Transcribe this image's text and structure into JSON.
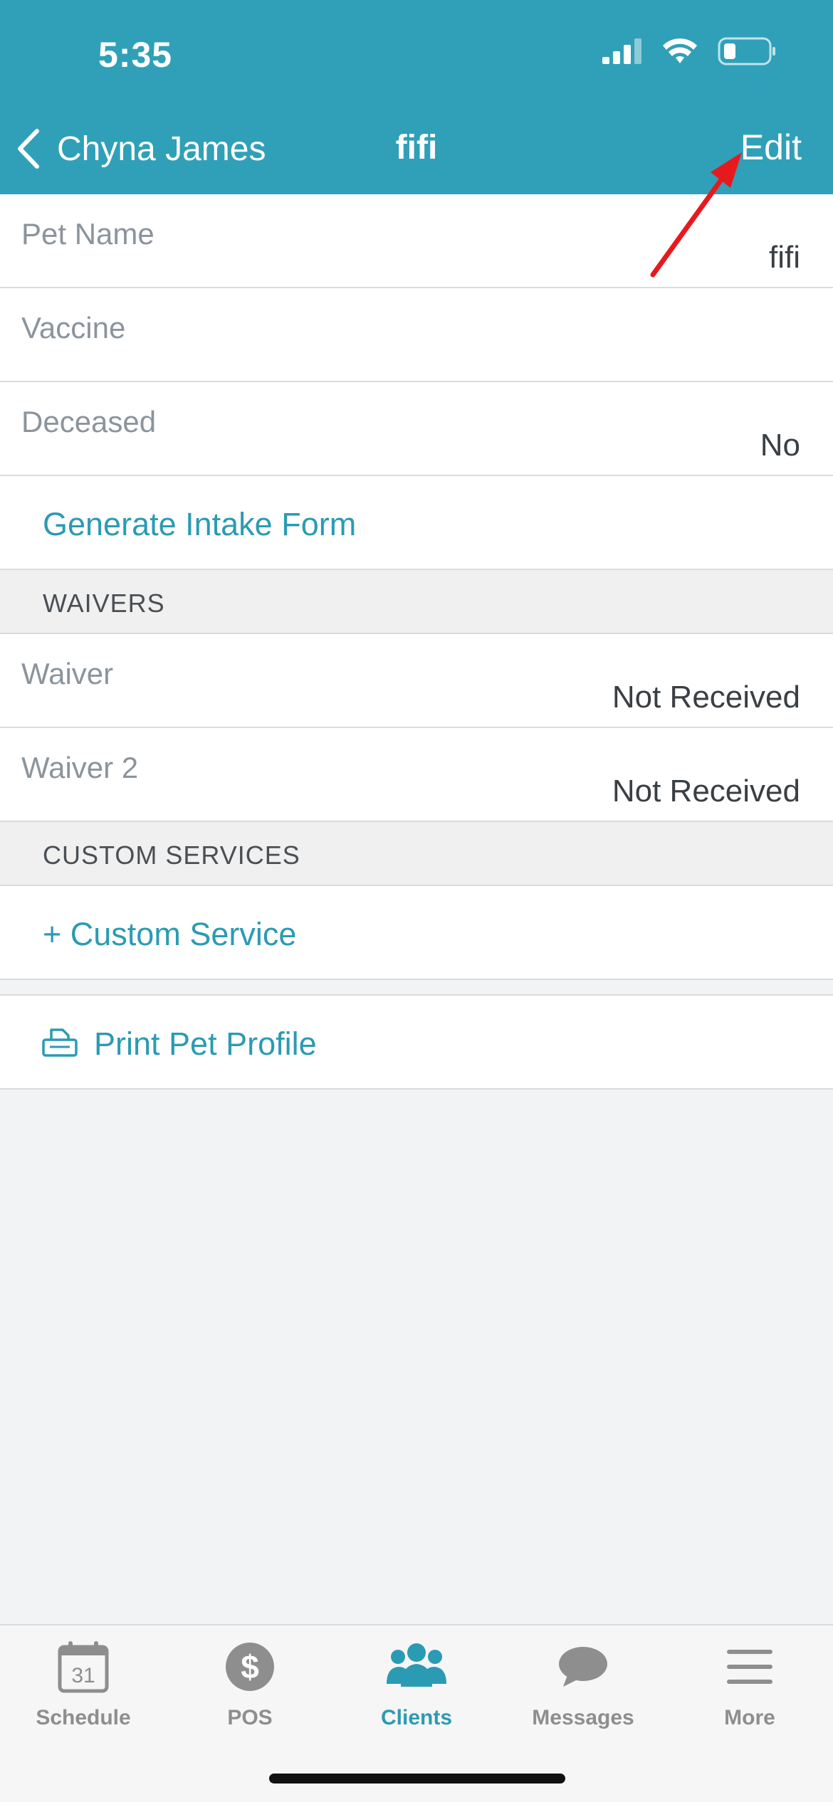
{
  "status_bar": {
    "time": "5:35"
  },
  "nav": {
    "back_label": "Chyna James",
    "title": "fifi",
    "edit_label": "Edit"
  },
  "rows": {
    "pet_name": {
      "label": "Pet Name",
      "value": "fifi"
    },
    "vaccine": {
      "label": "Vaccine"
    },
    "deceased": {
      "label": "Deceased",
      "value": "No"
    }
  },
  "generate_intake": "Generate Intake Form",
  "waivers": {
    "header": "WAIVERS",
    "items": [
      {
        "label": "Waiver",
        "value": "Not Received"
      },
      {
        "label": "Waiver 2",
        "value": "Not Received"
      }
    ]
  },
  "custom_services": {
    "header": "CUSTOM SERVICES",
    "add_label": "+ Custom Service"
  },
  "print_profile": "Print Pet Profile",
  "tabs": [
    {
      "label": "Schedule",
      "icon": "calendar-icon",
      "badge": "31"
    },
    {
      "label": "POS",
      "icon": "dollar-icon",
      "badge": "$"
    },
    {
      "label": "Clients",
      "icon": "clients-icon",
      "active": true
    },
    {
      "label": "Messages",
      "icon": "chat-bubble-icon"
    },
    {
      "label": "More",
      "icon": "menu-icon"
    }
  ],
  "colors": {
    "header": "#30a0b8",
    "accent": "#2b9bb3",
    "annotation": "#e8191e"
  }
}
